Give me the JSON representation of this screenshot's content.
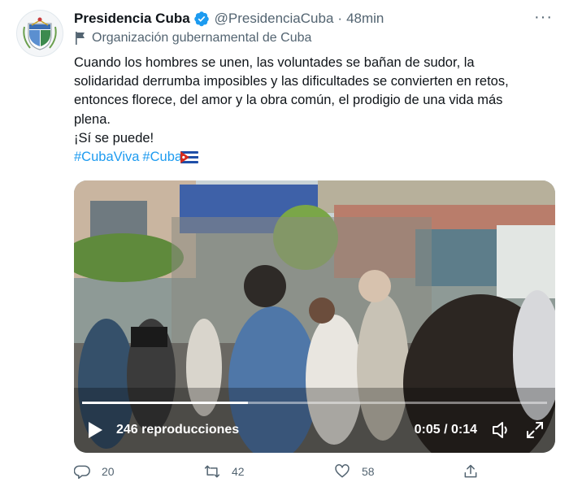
{
  "tweet": {
    "author_name": "Presidencia Cuba",
    "handle": "@PresidenciaCuba",
    "separator": "·",
    "time": "48min",
    "label": "Organización gubernamental de Cuba",
    "text_lines": [
      "Cuando los hombres se unen, las voluntades se bañan de sudor, la",
      "solidaridad derrumba imposibles y las dificultades se convierten en retos,",
      "entonces florece, del amor y la obra común, el prodigio de una vida más",
      "plena.",
      "¡Sí se puede!"
    ],
    "hashtags": [
      "#CubaViva",
      "#Cuba"
    ],
    "hashtag_color": "#1d9bf0",
    "verified_color": "#1d9bf0"
  },
  "video": {
    "views": "246 reproducciones",
    "timecode": "0:05 / 0:14",
    "progress": 0.357
  },
  "actions": {
    "replies": "20",
    "retweets": "42",
    "likes": "58"
  },
  "icons": [
    "more-icon",
    "verified-icon",
    "government-flag-icon",
    "cuba-flag-emoji",
    "play-icon",
    "volume-icon",
    "fullscreen-icon",
    "reply-icon",
    "retweet-icon",
    "like-icon",
    "share-icon"
  ]
}
